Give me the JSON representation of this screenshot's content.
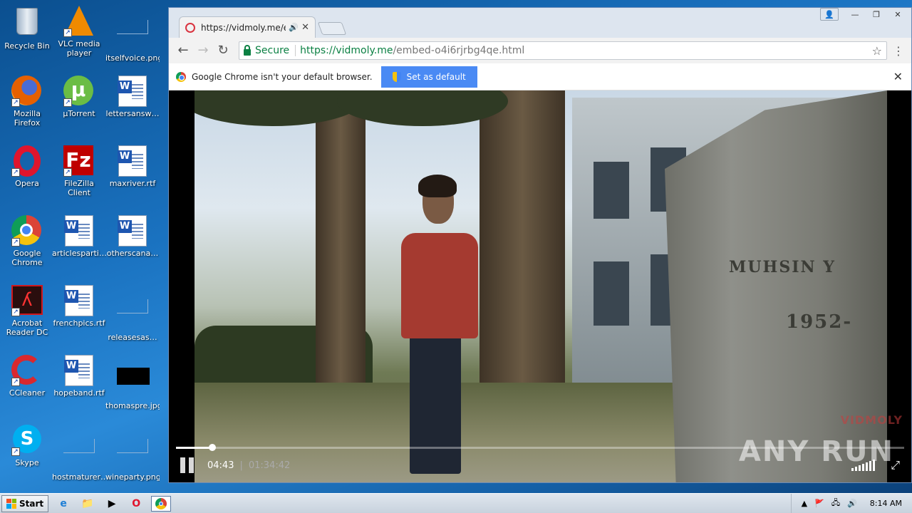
{
  "desktop": {
    "icons": [
      {
        "label": "Recycle Bin",
        "icon": "recycle-bin-icon"
      },
      {
        "label": "VLC media player",
        "icon": "vlc-icon"
      },
      {
        "label": "itselfvoice.png",
        "icon": "image-file-icon"
      },
      {
        "label": "Mozilla Firefox",
        "icon": "firefox-icon"
      },
      {
        "label": "µTorrent",
        "icon": "utorrent-icon"
      },
      {
        "label": "lettersansw…",
        "icon": "word-doc-icon"
      },
      {
        "label": "Opera",
        "icon": "opera-icon"
      },
      {
        "label": "FileZilla Client",
        "icon": "filezilla-icon"
      },
      {
        "label": "maxriver.rtf",
        "icon": "word-doc-icon"
      },
      {
        "label": "Google Chrome",
        "icon": "chrome-icon"
      },
      {
        "label": "articlesparti…",
        "icon": "word-doc-icon"
      },
      {
        "label": "otherscana…",
        "icon": "word-doc-icon"
      },
      {
        "label": "Acrobat Reader DC",
        "icon": "acrobat-icon"
      },
      {
        "label": "frenchpics.rtf",
        "icon": "word-doc-icon"
      },
      {
        "label": "releasesas…",
        "icon": "image-file-icon"
      },
      {
        "label": "CCleaner",
        "icon": "ccleaner-icon"
      },
      {
        "label": "hopeband.rtf",
        "icon": "word-doc-icon"
      },
      {
        "label": "thomaspre.jpg",
        "icon": "image-file-icon"
      },
      {
        "label": "Skype",
        "icon": "skype-icon"
      },
      {
        "label": "hostmaturer…",
        "icon": "image-file-icon"
      },
      {
        "label": "wineparty.png",
        "icon": "image-file-icon"
      }
    ]
  },
  "browser": {
    "tab_title": "https://vidmoly.me/emb",
    "secure_label": "Secure",
    "url_host": "https://vidmoly.me",
    "url_path": "/embed-o4i6rjrbg4qe.html",
    "infobar_text": "Google Chrome isn't your default browser.",
    "set_default_label": "Set as default"
  },
  "video": {
    "current_time": "04:43",
    "duration": "01:34:42",
    "progress_fraction": 0.05,
    "watermark": "VIDMOLY",
    "stone_line1": "MUHSIN Y",
    "stone_line2": "1952-"
  },
  "overlay": {
    "brand": "ANY RUN"
  },
  "taskbar": {
    "start_label": "Start",
    "clock": "8:14 AM"
  },
  "colors": {
    "secure_green": "#0b8043",
    "infobar_button": "#4a8af4",
    "desktop_blue": "#1a72c0"
  }
}
